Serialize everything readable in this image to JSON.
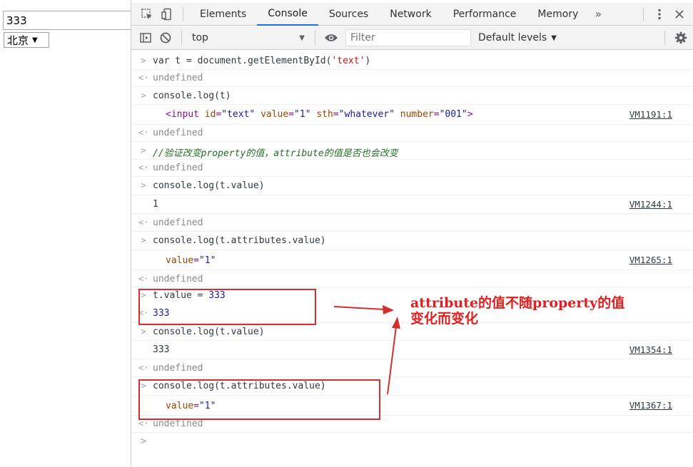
{
  "page": {
    "input_value": "333",
    "select_value": "北京"
  },
  "devtools": {
    "tabs": [
      "Elements",
      "Console",
      "Sources",
      "Network",
      "Performance",
      "Memory"
    ],
    "active_tab": "Console",
    "more_tabs": "»",
    "context": "top",
    "filter_placeholder": "Filter",
    "levels": "Default levels"
  },
  "console": {
    "lines": {
      "l1": "var t = document.getElementById(",
      "l1_str": "'text'",
      "l1_end": ")",
      "l2": "undefined",
      "l3": "console.log(t)",
      "l4_tag_open": "<input ",
      "l4_a1": "id",
      "l4_v1": "\"text\"",
      "l4_a2": "value",
      "l4_v2": "\"1\"",
      "l4_a3": "sth",
      "l4_v3": "\"whatever\"",
      "l4_a4": "number",
      "l4_v4": "\"001\"",
      "l4_tag_close": ">",
      "l4_src": "VM1191:1",
      "l5": "undefined",
      "l6": "//验证改变property的值，attribute的值是否也会改变",
      "l7": "undefined",
      "l8": "console.log(t.value)",
      "l9": "1",
      "l9_src": "VM1244:1",
      "l10": "undefined",
      "l11": "console.log(t.attributes.value)",
      "l12_attr": "value",
      "l12_val": "\"1\"",
      "l12_src": "VM1265:1",
      "l13": "undefined",
      "l14": "t.value = ",
      "l14_num": "333",
      "l15": "333",
      "l16": "console.log(t.value)",
      "l17": "333",
      "l17_src": "VM1354:1",
      "l18": "undefined",
      "l19": "console.log(t.attributes.value)",
      "l20_attr": "value",
      "l20_val": "\"1\"",
      "l20_src": "VM1367:1",
      "l21": "undefined"
    }
  },
  "annotation": {
    "line1": "attribute的值不随property的值",
    "line2": "变化而变化",
    "color": "#e02020"
  }
}
